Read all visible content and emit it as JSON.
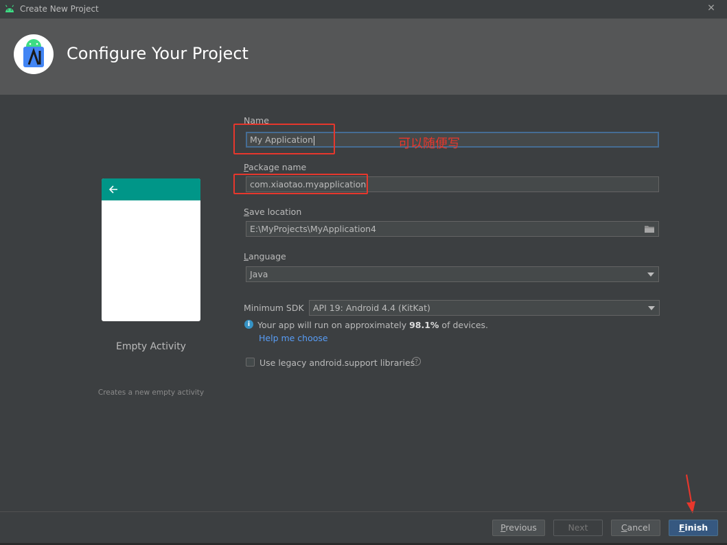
{
  "window": {
    "title": "Create New Project",
    "close_glyph": "✕"
  },
  "header": {
    "title": "Configure Your Project",
    "logo_icon": "android-studio-icon"
  },
  "template": {
    "name": "Empty Activity",
    "description": "Creates a new empty activity",
    "appbar_color": "#009688"
  },
  "form": {
    "name": {
      "label_u": "N",
      "label_rest": "ame",
      "value": "My Application"
    },
    "package": {
      "label_u": "P",
      "label_rest": "ackage name",
      "value": "com.xiaotao.myapplication"
    },
    "save_location": {
      "label_u": "S",
      "label_rest": "ave location",
      "value": "E:\\MyProjects\\MyApplication4"
    },
    "language": {
      "label_u": "L",
      "label_rest": "anguage",
      "value": "Java"
    },
    "min_sdk": {
      "label": "Minimum SDK",
      "value": "API 19: Android 4.4 (KitKat)"
    },
    "info": {
      "prefix": "Your app will run on approximately ",
      "percent": "98.1%",
      "suffix": " of devices."
    },
    "help_link": "Help me choose",
    "legacy": {
      "label": "Use legacy android.support libraries",
      "checked": false
    }
  },
  "annotation": {
    "text": "可以随便写",
    "color": "#e8372c"
  },
  "buttons": {
    "previous": {
      "label_u": "P",
      "label_rest": "revious"
    },
    "next": {
      "label": "Next"
    },
    "cancel": {
      "label_u": "C",
      "label_rest": "ancel"
    },
    "finish": {
      "label_u": "F",
      "label_rest": "inish"
    }
  }
}
